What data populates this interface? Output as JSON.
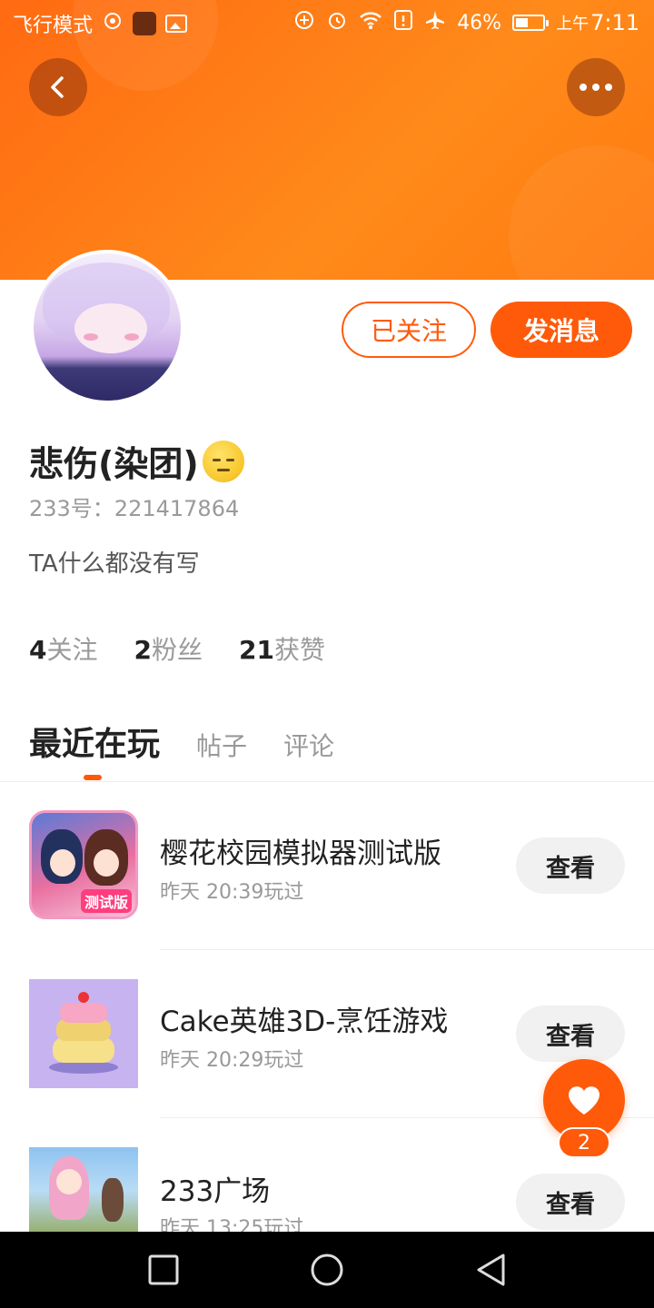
{
  "status_bar": {
    "mode": "飞行模式",
    "battery": "46%",
    "battery_level": 0.46,
    "ampm": "上午",
    "time": "7:11"
  },
  "header": {
    "back_icon": "chevron-left-icon",
    "more_icon": "more-horizontal-icon",
    "banner_color": "#ff7a10"
  },
  "profile": {
    "name": "悲伤(染团)",
    "emoji": "pensive-face-emoji",
    "id_label": "233号：221417864",
    "bio": "TA什么都没有写",
    "follow_button": "已关注",
    "message_button": "发消息",
    "accent_color": "#ff5a0a"
  },
  "stats": [
    {
      "count": "4",
      "label": "关注"
    },
    {
      "count": "2",
      "label": "粉丝"
    },
    {
      "count": "21",
      "label": "获赞"
    }
  ],
  "tabs": [
    {
      "label": "最近在玩",
      "active": true
    },
    {
      "label": "帖子",
      "active": false
    },
    {
      "label": "评论",
      "active": false
    }
  ],
  "games": [
    {
      "title": "樱花校园模拟器测试版",
      "time": "昨天 20:39玩过",
      "button": "查看",
      "icon_tag": "测试版"
    },
    {
      "title": "Cake英雄3D-烹饪游戏",
      "time": "昨天 20:29玩过",
      "button": "查看"
    },
    {
      "title": "233广场",
      "time": "昨天 13:25玩过",
      "button": "查看"
    }
  ],
  "like": {
    "icon": "heart-icon",
    "count": "2"
  },
  "nav": {
    "recents_icon": "square-icon",
    "home_icon": "circle-icon",
    "back_icon": "triangle-back-icon"
  }
}
